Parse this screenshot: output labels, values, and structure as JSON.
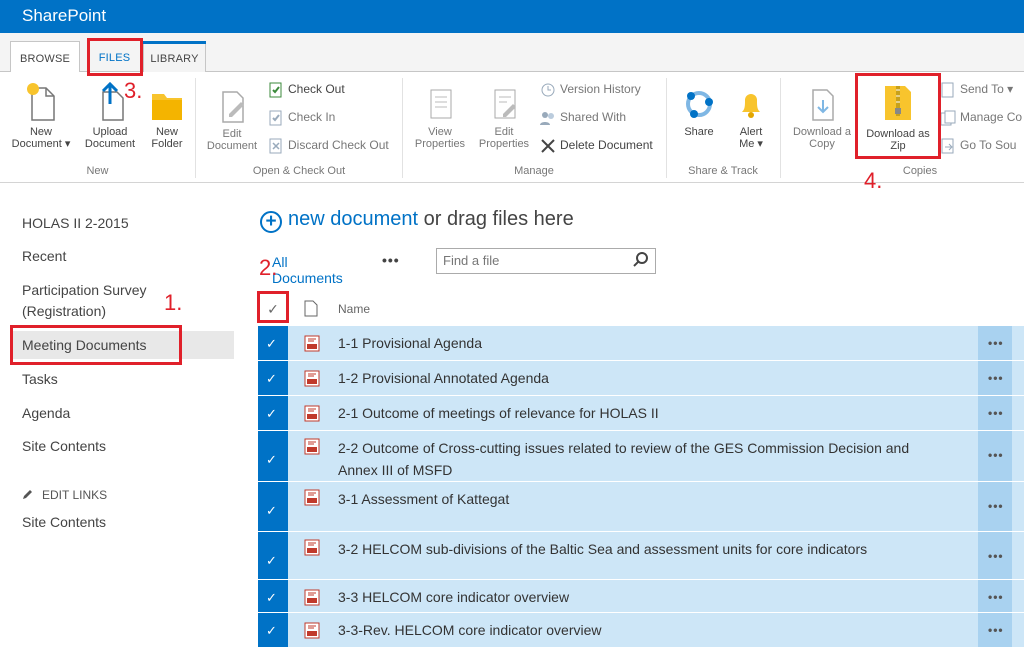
{
  "app": {
    "brand": "SharePoint"
  },
  "tabs": {
    "browse": "BROWSE",
    "files": "FILES",
    "library": "LIBRARY"
  },
  "ribbon": {
    "new_document": {
      "line1": "New",
      "line2": "Document"
    },
    "upload_document": {
      "line1": "Upload",
      "line2": "Document"
    },
    "new_folder": {
      "line1": "New",
      "line2": "Folder"
    },
    "group_new": "New",
    "edit_document": {
      "line1": "Edit",
      "line2": "Document"
    },
    "check_out": "Check Out",
    "check_in": "Check In",
    "discard_check_out": "Discard Check Out",
    "group_open": "Open & Check Out",
    "view_properties": {
      "line1": "View",
      "line2": "Properties"
    },
    "edit_properties": {
      "line1": "Edit",
      "line2": "Properties"
    },
    "version_history": "Version History",
    "shared_with": "Shared With",
    "delete_document": "Delete Document",
    "group_manage": "Manage",
    "share": "Share",
    "alert_me": {
      "line1": "Alert",
      "line2": "Me"
    },
    "group_share": "Share & Track",
    "download_copy": {
      "line1": "Download a",
      "line2": "Copy"
    },
    "download_zip": {
      "line1": "Download as",
      "line2": "Zip"
    },
    "send_to": "Send To",
    "manage_copies": "Manage Co",
    "go_to_source": "Go To Sou",
    "group_copies": "Copies"
  },
  "nav": {
    "items": [
      "HOLAS II 2-2015",
      "Recent",
      "Participation Survey (Registration)",
      "Meeting Documents",
      "Tasks",
      "Agenda",
      "Site Contents"
    ],
    "edit_links": "EDIT LINKS",
    "site_contents_2": "Site Contents"
  },
  "main": {
    "new_document": "new document",
    "drag_text": " or drag files here",
    "all_documents": "All Documents",
    "ellipsis": "•••",
    "find_placeholder": "Find a file",
    "name_header": "Name"
  },
  "documents": [
    "1-1 Provisional Agenda",
    "1-2 Provisional Annotated Agenda",
    "2-1 Outcome of meetings of relevance for HOLAS II",
    "2-2 Outcome of Cross-cutting issues related to review of the GES Commission Decision and Annex III of MSFD",
    "3-1 Assessment of Kattegat",
    "3-2 HELCOM sub-divisions of the Baltic Sea and assessment units for core indicators",
    "3-3 HELCOM core indicator overview",
    "3-3-Rev. HELCOM core indicator overview"
  ],
  "annotations": {
    "a1": "1.",
    "a2": "2.",
    "a3": "3.",
    "a4": "4."
  },
  "colors": {
    "suitebar": "#0072c6",
    "selected_row": "#cde6f7",
    "annotation": "#e0202a"
  }
}
